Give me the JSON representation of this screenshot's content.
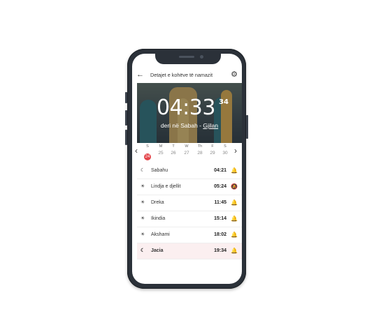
{
  "header": {
    "title": "Detajet e kohëve të namazit",
    "back_icon": "←",
    "settings_icon": "⚙"
  },
  "countdown": {
    "time": "04:33",
    "seconds": "34",
    "until_prefix": "deri në Sabah - ",
    "city": "Gjilan"
  },
  "calendar": {
    "prev_icon": "‹",
    "next_icon": "›",
    "days": [
      {
        "dow": "S",
        "num": "24",
        "active": true
      },
      {
        "dow": "M",
        "num": "25"
      },
      {
        "dow": "T",
        "num": "26"
      },
      {
        "dow": "W",
        "num": "27"
      },
      {
        "dow": "Th",
        "num": "28"
      },
      {
        "dow": "F",
        "num": "29"
      },
      {
        "dow": "S",
        "num": "30"
      }
    ]
  },
  "prayers": [
    {
      "icon": "☾",
      "name": "Sabahu",
      "time": "04:21",
      "bell": "🔔"
    },
    {
      "icon": "☀",
      "name": "Lindja e djellit",
      "time": "05:24",
      "bell": "🔕"
    },
    {
      "icon": "☀",
      "name": "Dreka",
      "time": "11:45",
      "bell": "🔔"
    },
    {
      "icon": "☀",
      "name": "Ikindia",
      "time": "15:14",
      "bell": "🔔"
    },
    {
      "icon": "☀",
      "name": "Akshami",
      "time": "18:02",
      "bell": "🔔"
    },
    {
      "icon": "☾",
      "name": "Jacia",
      "time": "19:34",
      "bell": "🔔",
      "current": true
    }
  ],
  "colors": {
    "accent": "#e4464b",
    "current_row": "#fbeff0",
    "phone_frame": "#2b3139"
  }
}
